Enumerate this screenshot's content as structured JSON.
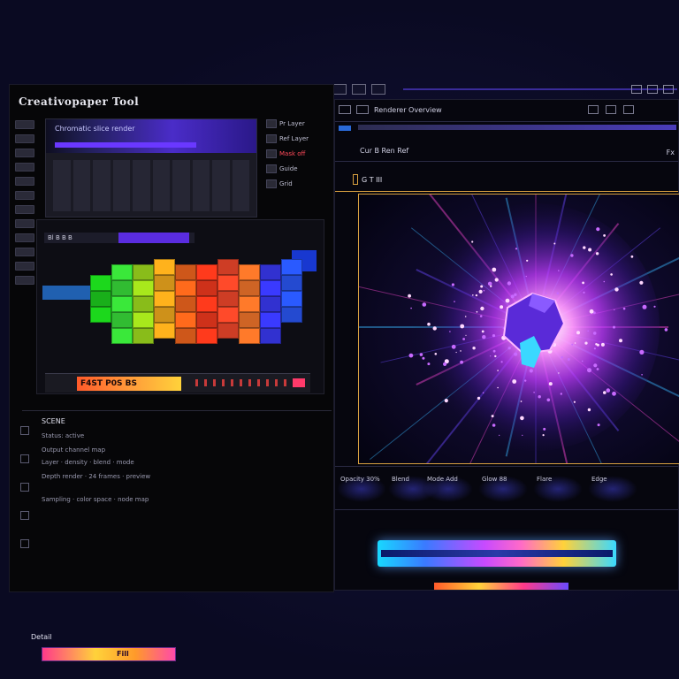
{
  "app": {
    "title": "Creativopaper Tool"
  },
  "left_panel": {
    "thumb_header_label": "Chromatic slice render",
    "side_list": [
      {
        "label": "Pr Layer",
        "accent": false
      },
      {
        "label": "Ref Layer",
        "accent": false
      },
      {
        "label": "Mask off",
        "accent": true
      },
      {
        "label": "Guide",
        "accent": false
      },
      {
        "label": "Grid",
        "accent": false
      }
    ],
    "heat_top_label": "Bl  B  B  B",
    "timeline_label": "F4ST P0S BS",
    "properties": {
      "header": "SCENE",
      "lines": [
        "Status: active",
        "Output channel map",
        "Layer · density · blend · mode",
        "Depth render · 24 frames · preview",
        "Sampling · color space · node map"
      ]
    },
    "footer_label": "Detail",
    "footer_bar_label": "Fill"
  },
  "right_panel": {
    "title": "Renderer Overview",
    "toolbar_info": "Cur  B  Ren  Ref",
    "toolbar_info_right": "Fx",
    "subbar_text": "G  T  III",
    "controls": [
      "Opacity  30%",
      "Blend",
      "Mode  Add",
      "Glow  88",
      "Flare",
      "Edge"
    ]
  },
  "colors": {
    "accent_purple": "#6a38ff",
    "accent_gold": "#d8a040",
    "burst_magenta": "#d23cff",
    "burst_core_cyan": "#3ad8ff"
  },
  "icons": [
    "layer-icon",
    "settings-icon",
    "toolbar-icon",
    "window-icon",
    "close-icon"
  ]
}
